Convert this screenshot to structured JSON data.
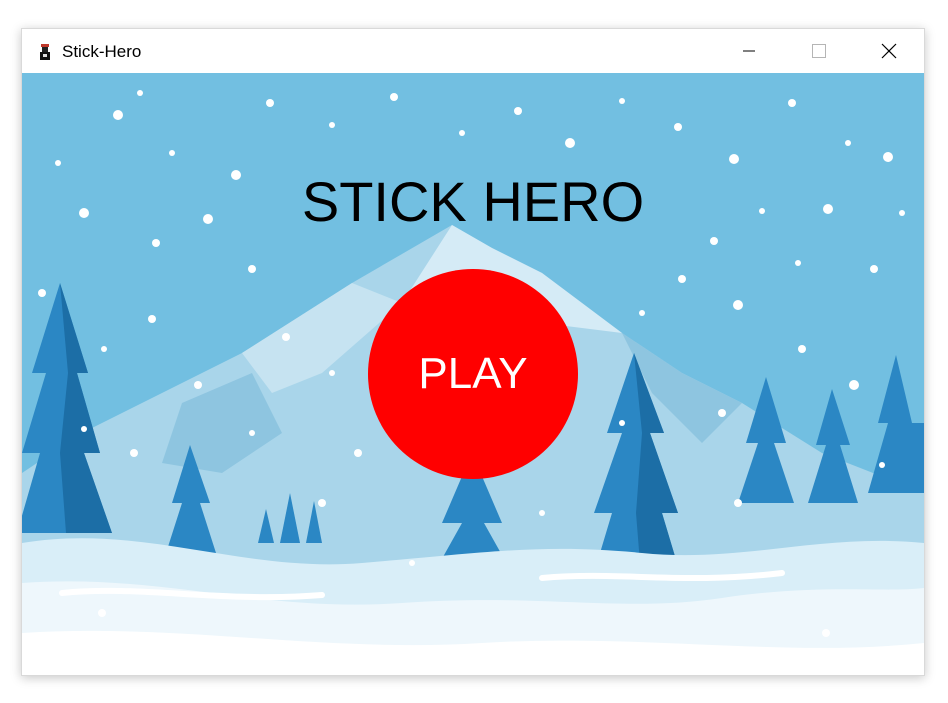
{
  "window": {
    "title": "Stick-Hero",
    "controls": {
      "minimize_icon": "minimize-icon",
      "maximize_icon": "maximize-icon",
      "close_icon": "close-icon"
    }
  },
  "game": {
    "title": "STICK HERO",
    "play_label": "PLAY",
    "play_color": "#ff0000"
  },
  "colors": {
    "sky": "#72bfe1",
    "mountain": "#a8d4e9",
    "tree": "#2b87c4",
    "snow": "#eef7fc"
  }
}
